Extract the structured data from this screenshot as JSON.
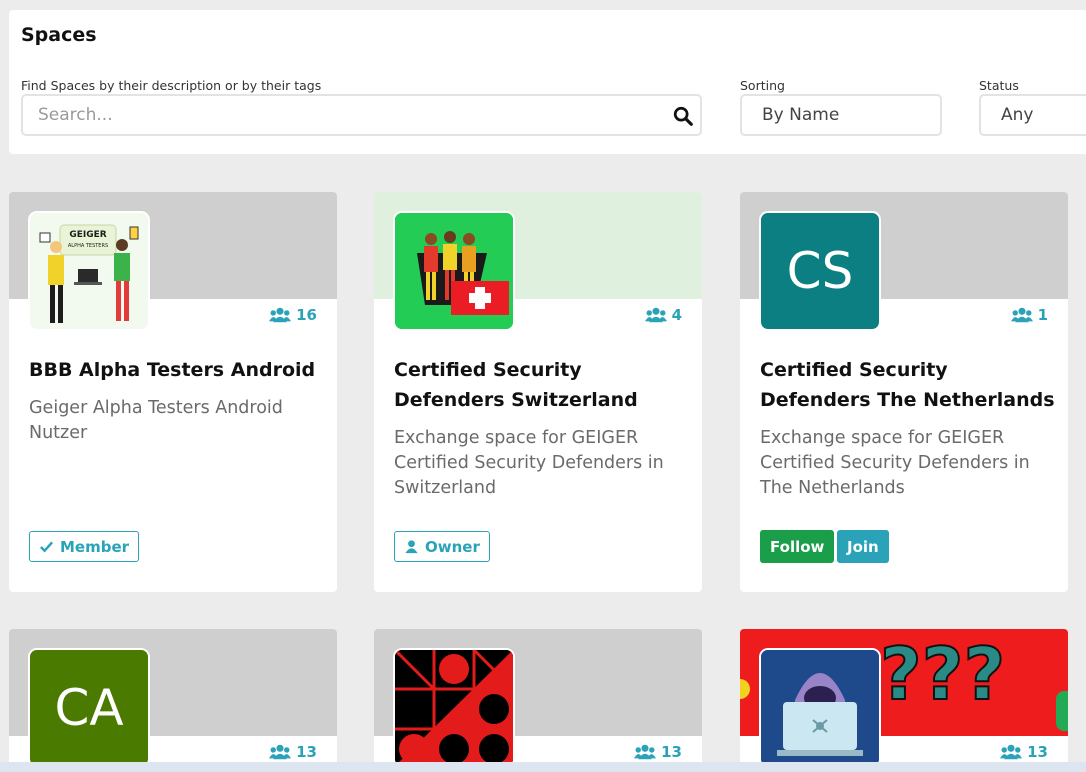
{
  "page": {
    "title": "Spaces"
  },
  "filters": {
    "search_label": "Find Spaces by their description or by their tags",
    "search_placeholder": "Search...",
    "sorting_label": "Sorting",
    "sorting_value": "By Name",
    "status_label": "Status",
    "status_value": "Any"
  },
  "colors": {
    "member_accent": "#2aa3b8",
    "follow_button": "#1a9e4a",
    "join_button": "#2aa3b8"
  },
  "cards": [
    {
      "title": "BBB Alpha Testers Android",
      "description": "Geiger Alpha Testers Android Nutzer",
      "member_count": "16",
      "avatar_text": "GEIGER",
      "avatar_subtext": "ALPHA TESTERS",
      "badge": "Member",
      "badge_icon": "check-icon"
    },
    {
      "title": "Certified Security Defenders Switzerland",
      "description": "Exchange space for GEIGER Certified Security Defenders in Switzerland",
      "member_count": "4",
      "badge": "Owner",
      "badge_icon": "user-icon"
    },
    {
      "title": "Certified Security Defenders The Netherlands",
      "description": "Exchange space for GEIGER Certified Security Defenders in The Netherlands",
      "member_count": "1",
      "avatar_initials": "CS",
      "avatar_color": "#0c7f82",
      "follow_label": "Follow",
      "join_label": "Join"
    },
    {
      "member_count": "13",
      "avatar_initials": "CA",
      "avatar_color": "#4a7a00"
    },
    {
      "member_count": "13"
    },
    {
      "member_count": "13"
    }
  ]
}
